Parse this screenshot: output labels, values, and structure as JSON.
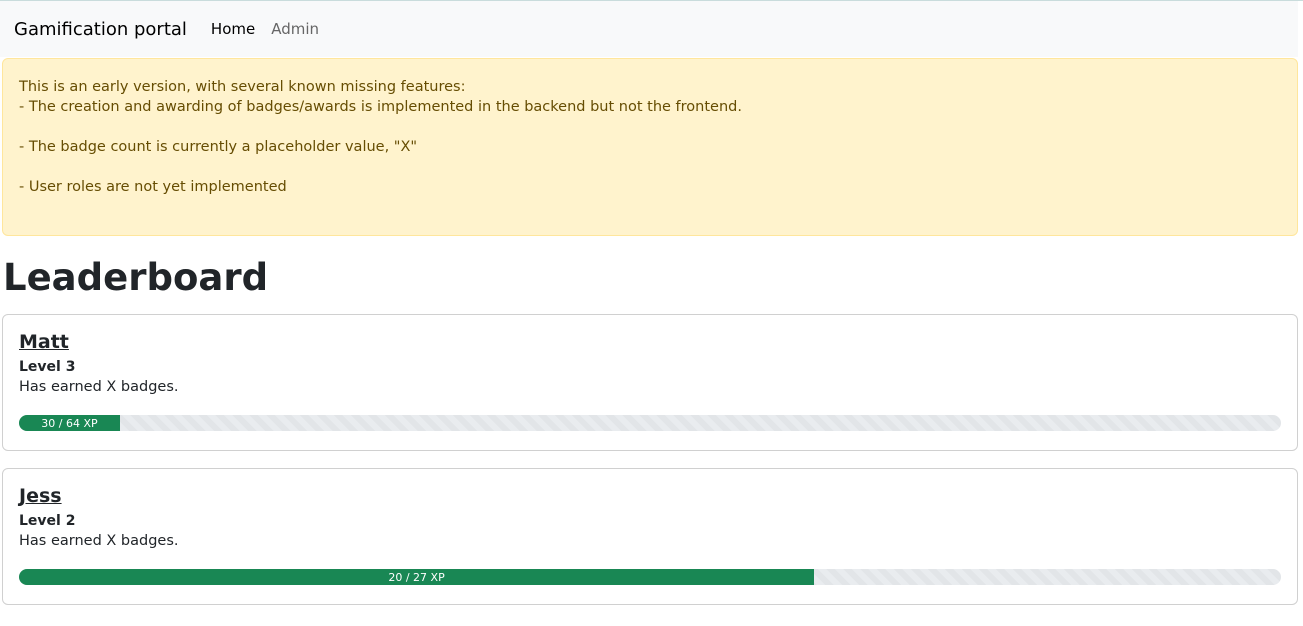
{
  "nav": {
    "brand": "Gamification portal",
    "links": [
      {
        "label": "Home",
        "active": true
      },
      {
        "label": "Admin",
        "active": false
      }
    ]
  },
  "alert": {
    "lines": [
      "This is an early version, with several known missing features:",
      "- The creation and awarding of badges/awards is implemented in the backend but not the frontend.",
      "- The badge count is currently a placeholder value, \"X\"",
      "- User roles are not yet implemented"
    ]
  },
  "heading": "Leaderboard",
  "users": [
    {
      "name": "Matt",
      "level": "Level 3",
      "badges": "Has earned X badges.",
      "xp_label": "30 / 64 XP",
      "progress_percent": 8
    },
    {
      "name": "Jess",
      "level": "Level 2",
      "badges": "Has earned X badges.",
      "xp_label": "20 / 27 XP",
      "progress_percent": 63
    }
  ],
  "colors": {
    "progress": "#198754",
    "alert_bg": "#fff3cd"
  }
}
